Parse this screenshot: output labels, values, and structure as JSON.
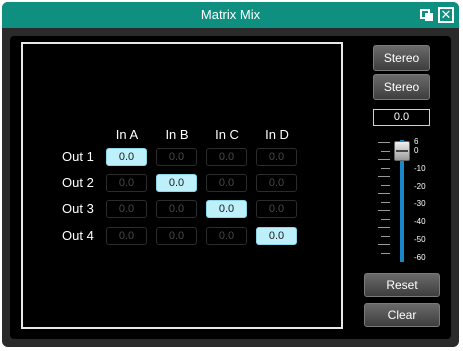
{
  "window": {
    "title": "Matrix Mix"
  },
  "matrix": {
    "columns": [
      "In A",
      "In B",
      "In C",
      "In D"
    ],
    "rows": [
      {
        "label": "Out 1",
        "values": [
          "0.0",
          "0.0",
          "0.0",
          "0.0"
        ]
      },
      {
        "label": "Out 2",
        "values": [
          "0.0",
          "0.0",
          "0.0",
          "0.0"
        ]
      },
      {
        "label": "Out 3",
        "values": [
          "0.0",
          "0.0",
          "0.0",
          "0.0"
        ]
      },
      {
        "label": "Out 4",
        "values": [
          "0.0",
          "0.0",
          "0.0",
          "0.0"
        ]
      }
    ],
    "active_cells": [
      [
        0,
        0
      ],
      [
        1,
        1
      ],
      [
        2,
        2
      ],
      [
        3,
        3
      ]
    ]
  },
  "controls": {
    "stereo_1": "Stereo",
    "stereo_2": "Stereo",
    "gain_value": "0.0",
    "reset": "Reset",
    "clear": "Clear"
  },
  "fader": {
    "scale": [
      "6",
      "0",
      "-10",
      "-20",
      "-30",
      "-40",
      "-50",
      "-60"
    ],
    "level_db": 0.0
  },
  "colors": {
    "titlebar": "#0f8f80",
    "active_cell": "#bdf0fb",
    "fader_track": "#1a88c8"
  },
  "icons": {
    "restore": "restore-window-icon",
    "close": "close-icon"
  }
}
